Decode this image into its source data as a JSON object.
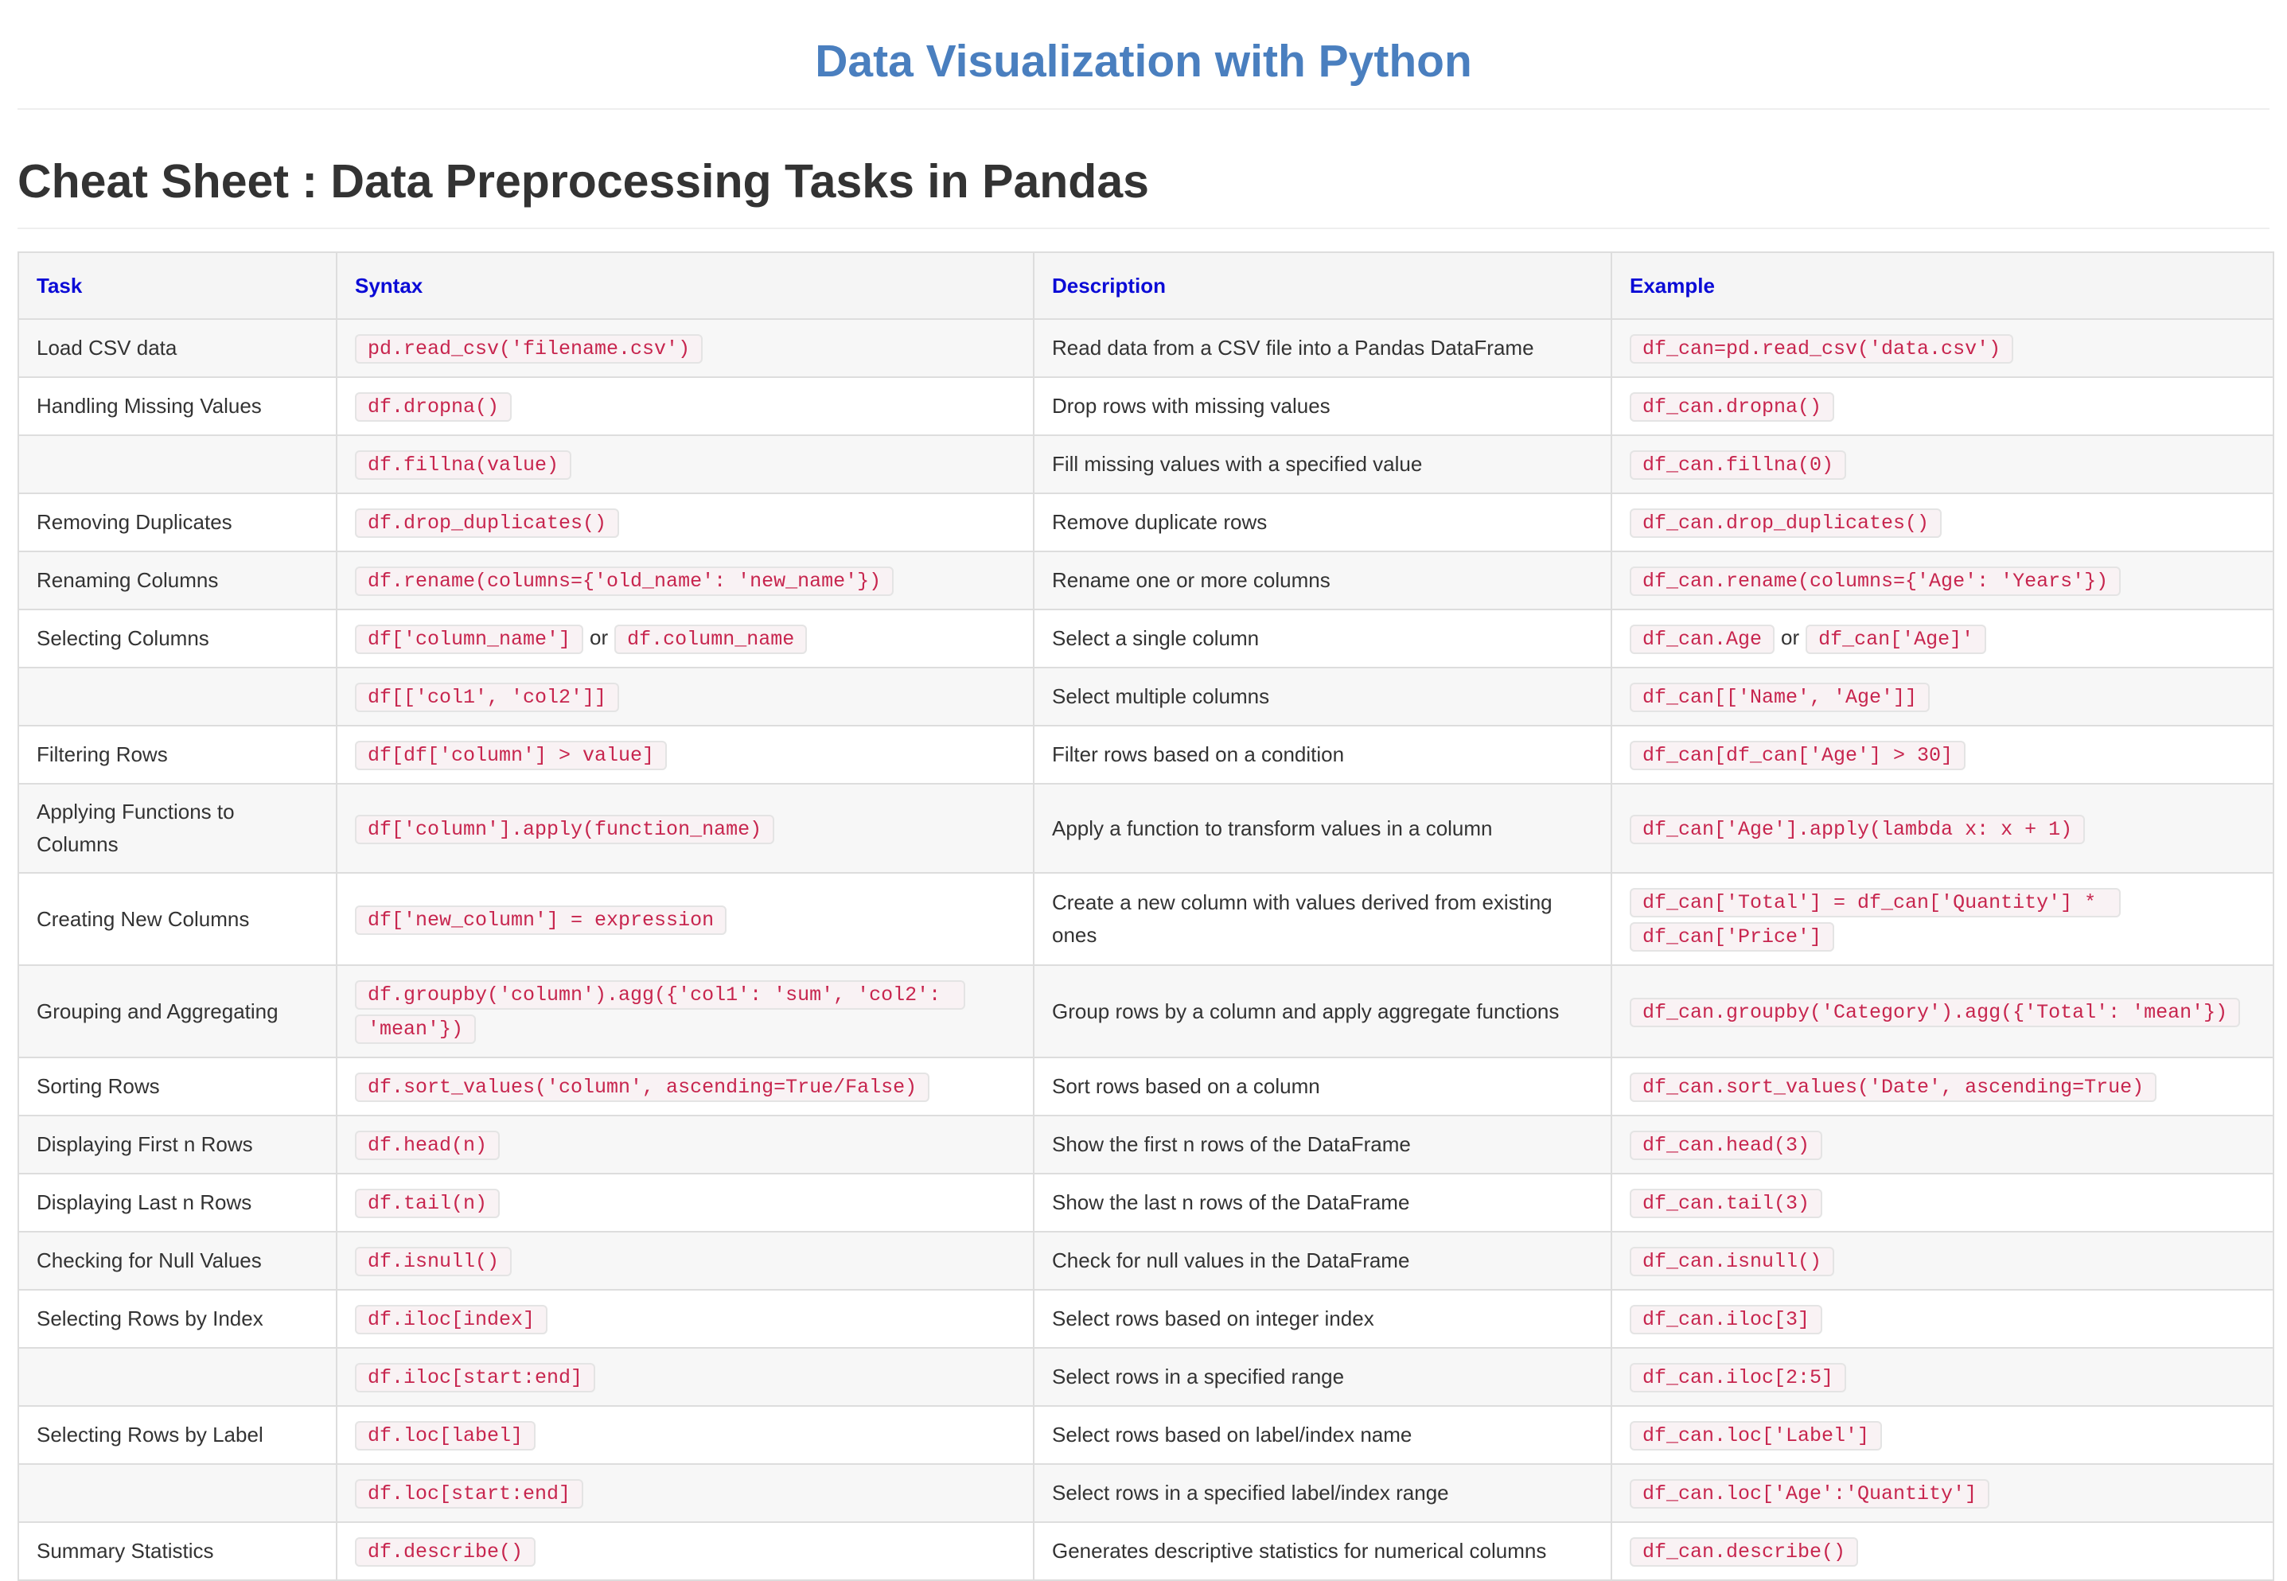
{
  "colors": {
    "title": "#4a7fbf",
    "header": "#0b0bd6",
    "code": "#c7254e"
  },
  "header": {
    "title": "Data Visualization with Python"
  },
  "section": {
    "title": "Cheat Sheet : Data Preprocessing Tasks in Pandas"
  },
  "table": {
    "columns": [
      "Task",
      "Syntax",
      "Description",
      "Example"
    ],
    "rows": [
      {
        "task": "Load CSV data",
        "syntax": [
          "pd.read_csv('filename.csv')"
        ],
        "description": "Read data from a CSV file into a Pandas DataFrame",
        "example": [
          "df_can=pd.read_csv('data.csv')"
        ]
      },
      {
        "task": "Handling Missing Values",
        "syntax": [
          "df.dropna()"
        ],
        "description": "Drop rows with missing values",
        "example": [
          "df_can.dropna()"
        ]
      },
      {
        "task": "",
        "syntax": [
          "df.fillna(value)"
        ],
        "description": "Fill missing values with a specified value",
        "example": [
          "df_can.fillna(0)"
        ]
      },
      {
        "task": "Removing Duplicates",
        "syntax": [
          "df.drop_duplicates()"
        ],
        "description": "Remove duplicate rows",
        "example": [
          "df_can.drop_duplicates()"
        ]
      },
      {
        "task": "Renaming Columns",
        "syntax": [
          "df.rename(columns={'old_name': 'new_name'})"
        ],
        "description": "Rename one or more columns",
        "example": [
          "df_can.rename(columns={'Age': 'Years'})"
        ]
      },
      {
        "task": "Selecting Columns",
        "syntax": [
          "df['column_name']",
          "df.column_name"
        ],
        "description": "Select a single column",
        "example": [
          "df_can.Age",
          "df_can['Age]'"
        ]
      },
      {
        "task": "",
        "syntax": [
          "df[['col1', 'col2']]"
        ],
        "description": "Select multiple columns",
        "example": [
          "df_can[['Name', 'Age']]"
        ]
      },
      {
        "task": "Filtering Rows",
        "syntax": [
          "df[df['column'] > value]"
        ],
        "description": "Filter rows based on a condition",
        "example": [
          "df_can[df_can['Age'] > 30]"
        ]
      },
      {
        "task": "Applying Functions to Columns",
        "syntax": [
          "df['column'].apply(function_name)"
        ],
        "description": "Apply a function to transform values in a column",
        "example": [
          "df_can['Age'].apply(lambda x: x + 1)"
        ]
      },
      {
        "task": "Creating New Columns",
        "syntax": [
          "df['new_column'] = expression"
        ],
        "description": "Create a new column with values derived from existing ones",
        "example": [
          "df_can['Total'] = df_can['Quantity'] * df_can['Price']"
        ]
      },
      {
        "task": "Grouping and Aggregating",
        "syntax": [
          "df.groupby('column').agg({'col1': 'sum', 'col2': 'mean'})"
        ],
        "description": "Group rows by a column and apply aggregate functions",
        "example": [
          "df_can.groupby('Category').agg({'Total': 'mean'})"
        ]
      },
      {
        "task": "Sorting Rows",
        "syntax": [
          "df.sort_values('column', ascending=True/False)"
        ],
        "description": "Sort rows based on a column",
        "example": [
          "df_can.sort_values('Date', ascending=True)"
        ]
      },
      {
        "task": "Displaying First n Rows",
        "syntax": [
          "df.head(n)"
        ],
        "description": "Show the first n rows of the DataFrame",
        "example": [
          "df_can.head(3)"
        ]
      },
      {
        "task": "Displaying Last n Rows",
        "syntax": [
          "df.tail(n)"
        ],
        "description": "Show the last n rows of the DataFrame",
        "example": [
          "df_can.tail(3)"
        ]
      },
      {
        "task": "Checking for Null Values",
        "syntax": [
          "df.isnull()"
        ],
        "description": "Check for null values in the DataFrame",
        "example": [
          "df_can.isnull()"
        ]
      },
      {
        "task": "Selecting Rows by Index",
        "syntax": [
          "df.iloc[index]"
        ],
        "description": "Select rows based on integer index",
        "example": [
          "df_can.iloc[3]"
        ]
      },
      {
        "task": "",
        "syntax": [
          "df.iloc[start:end]"
        ],
        "description": "Select rows in a specified range",
        "example": [
          "df_can.iloc[2:5]"
        ]
      },
      {
        "task": "Selecting Rows by Label",
        "syntax": [
          "df.loc[label]"
        ],
        "description": "Select rows based on label/index name",
        "example": [
          "df_can.loc['Label']"
        ]
      },
      {
        "task": "",
        "syntax": [
          "df.loc[start:end]"
        ],
        "description": "Select rows in a specified label/index range",
        "example": [
          "df_can.loc['Age':'Quantity']"
        ]
      },
      {
        "task": "Summary Statistics",
        "syntax": [
          "df.describe()"
        ],
        "description": "Generates descriptive statistics for numerical columns",
        "example": [
          "df_can.describe()"
        ]
      }
    ],
    "joiner": "or"
  }
}
